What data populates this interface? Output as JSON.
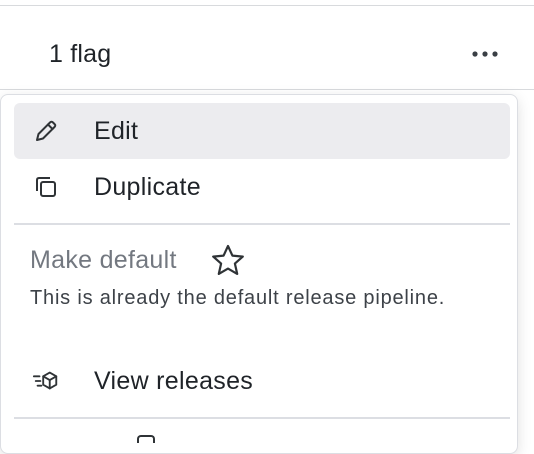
{
  "background": {
    "flag_count": "1 flag"
  },
  "menu": {
    "items": [
      {
        "label": "Edit",
        "icon": "pencil-icon"
      },
      {
        "label": "Duplicate",
        "icon": "duplicate-icon"
      }
    ],
    "make_default": {
      "label": "Make default",
      "icon": "star-icon",
      "description": "This is already the default release pipeline."
    },
    "view_releases": {
      "label": "View releases",
      "icon": "releases-icon"
    }
  },
  "colors": {
    "active_item_bg": "#ececef",
    "divider": "#dcdee3",
    "disabled_text": "#737880"
  }
}
